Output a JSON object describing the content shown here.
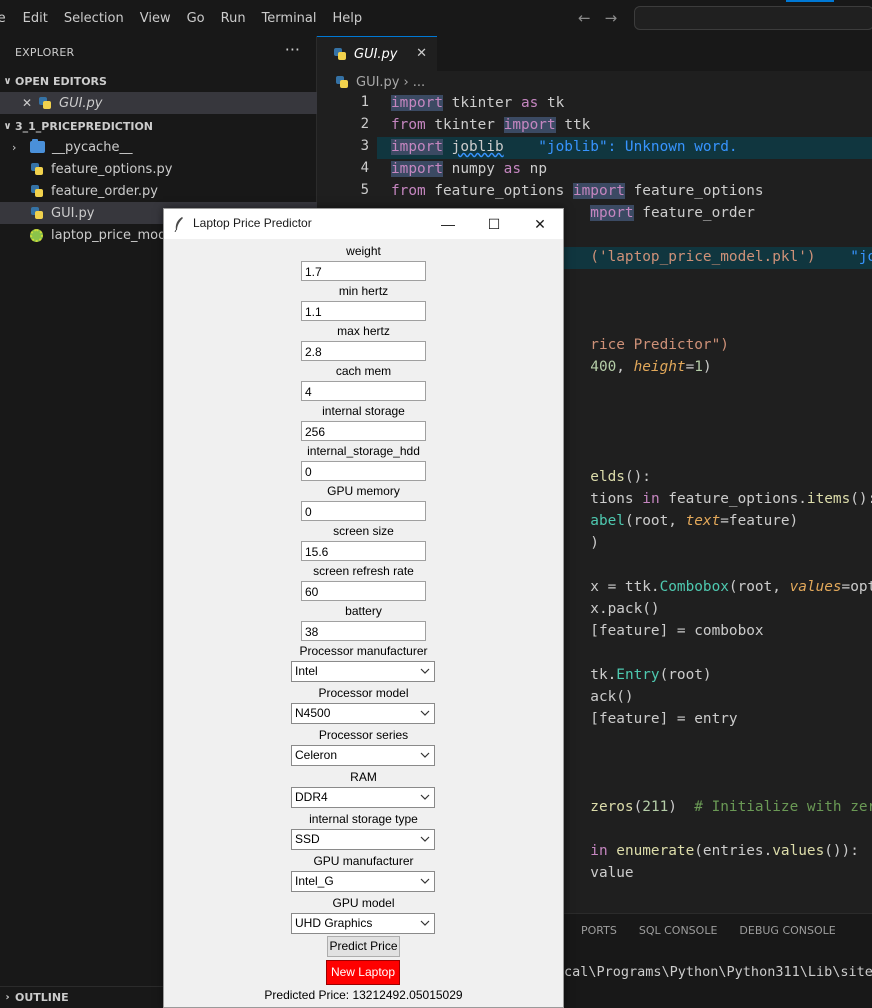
{
  "menubar": {
    "items": [
      "le",
      "Edit",
      "Selection",
      "View",
      "Go",
      "Run",
      "Terminal",
      "Help"
    ]
  },
  "sidebar": {
    "title": "EXPLORER",
    "more": "···",
    "open_editors": {
      "label": "OPEN EDITORS",
      "files": [
        {
          "name": "GUI.py"
        }
      ]
    },
    "project": {
      "label": "3_1_PRICEPREDICTION",
      "items": [
        {
          "name": "__pycache__",
          "type": "folder"
        },
        {
          "name": "feature_options.py",
          "type": "py"
        },
        {
          "name": "feature_order.py",
          "type": "py"
        },
        {
          "name": "GUI.py",
          "type": "py"
        },
        {
          "name": "laptop_price_model",
          "type": "model"
        }
      ]
    },
    "outline": "OUTLINE"
  },
  "editor": {
    "tab": "GUI.py",
    "breadcrumb": [
      "GUI.py",
      "..."
    ],
    "line_numbers": [
      "1",
      "2",
      "3",
      "4",
      "5"
    ],
    "code": {
      "l1": [
        "import",
        "tkinter",
        "as",
        "tk"
      ],
      "l2": [
        "from",
        "tkinter",
        "import",
        "ttk"
      ],
      "l3": [
        "import",
        "joblib",
        "\"joblib\": Unknown word."
      ],
      "l4": [
        "import",
        "numpy",
        "as",
        "np"
      ],
      "l5": [
        "from",
        "feature_options",
        "import",
        "feature_options"
      ],
      "l6": [
        "mport",
        "feature_order"
      ],
      "l8": [
        "('laptop_price_model.pkl')",
        "\"jobl"
      ],
      "l12": [
        "rice Predictor\")"
      ],
      "l13": [
        "400",
        ", ",
        "height",
        "=",
        "1",
        ")"
      ],
      "l18": [
        "elds",
        "():"
      ],
      "l19": [
        "tions",
        "in",
        "feature_options",
        ".",
        "items",
        "():"
      ],
      "l20": [
        "abel",
        "(root, ",
        "text",
        "=feature)"
      ],
      "l21": [
        ")"
      ],
      "l23": [
        "x = ttk.",
        "Combobox",
        "(root, ",
        "values",
        "=optio"
      ],
      "l24": [
        "x.pack()"
      ],
      "l25": [
        "[feature] = combobox"
      ],
      "l27": [
        "tk.",
        "Entry",
        "(root)"
      ],
      "l28": [
        "ack()"
      ],
      "l29": [
        "[feature] = entry"
      ],
      "l32": [
        "zeros",
        "(",
        "211",
        ")",
        "# Initialize with zero"
      ],
      "l34": [
        "in",
        "enumerate",
        "(entries.",
        "values",
        "()):"
      ],
      "l35": [
        "value"
      ]
    }
  },
  "panel": {
    "tabs": [
      "PORTS",
      "SQL CONSOLE",
      "DEBUG CONSOLE"
    ],
    "terminal_line": "cal\\Programs\\Python\\Python311\\Lib\\site"
  },
  "app": {
    "title": "Laptop Price Predictor",
    "fields": [
      {
        "label": "weight",
        "value": "1.7"
      },
      {
        "label": "min hertz",
        "value": "1.1"
      },
      {
        "label": "max hertz",
        "value": "2.8"
      },
      {
        "label": "cach mem",
        "value": "4"
      },
      {
        "label": "internal storage",
        "value": "256"
      },
      {
        "label": "internal_storage_hdd",
        "value": "0"
      },
      {
        "label": "GPU memory",
        "value": "0"
      },
      {
        "label": "screen size",
        "value": "15.6"
      },
      {
        "label": "screen refresh rate",
        "value": "60"
      },
      {
        "label": "battery",
        "value": "38"
      }
    ],
    "combos": [
      {
        "label": "Processor manufacturer",
        "value": "Intel"
      },
      {
        "label": "Processor model",
        "value": "N4500"
      },
      {
        "label": "Processor series",
        "value": "Celeron"
      },
      {
        "label": "RAM",
        "value": "DDR4"
      },
      {
        "label": "internal storage type",
        "value": "SSD"
      },
      {
        "label": "GPU manufacturer",
        "value": "Intel_G"
      },
      {
        "label": "GPU model",
        "value": "UHD Graphics"
      }
    ],
    "predict_button": "Predict Price",
    "new_button": "New Laptop",
    "new_button_color": "#ff0000",
    "result": "Predicted Price: 13212492.05015029"
  }
}
